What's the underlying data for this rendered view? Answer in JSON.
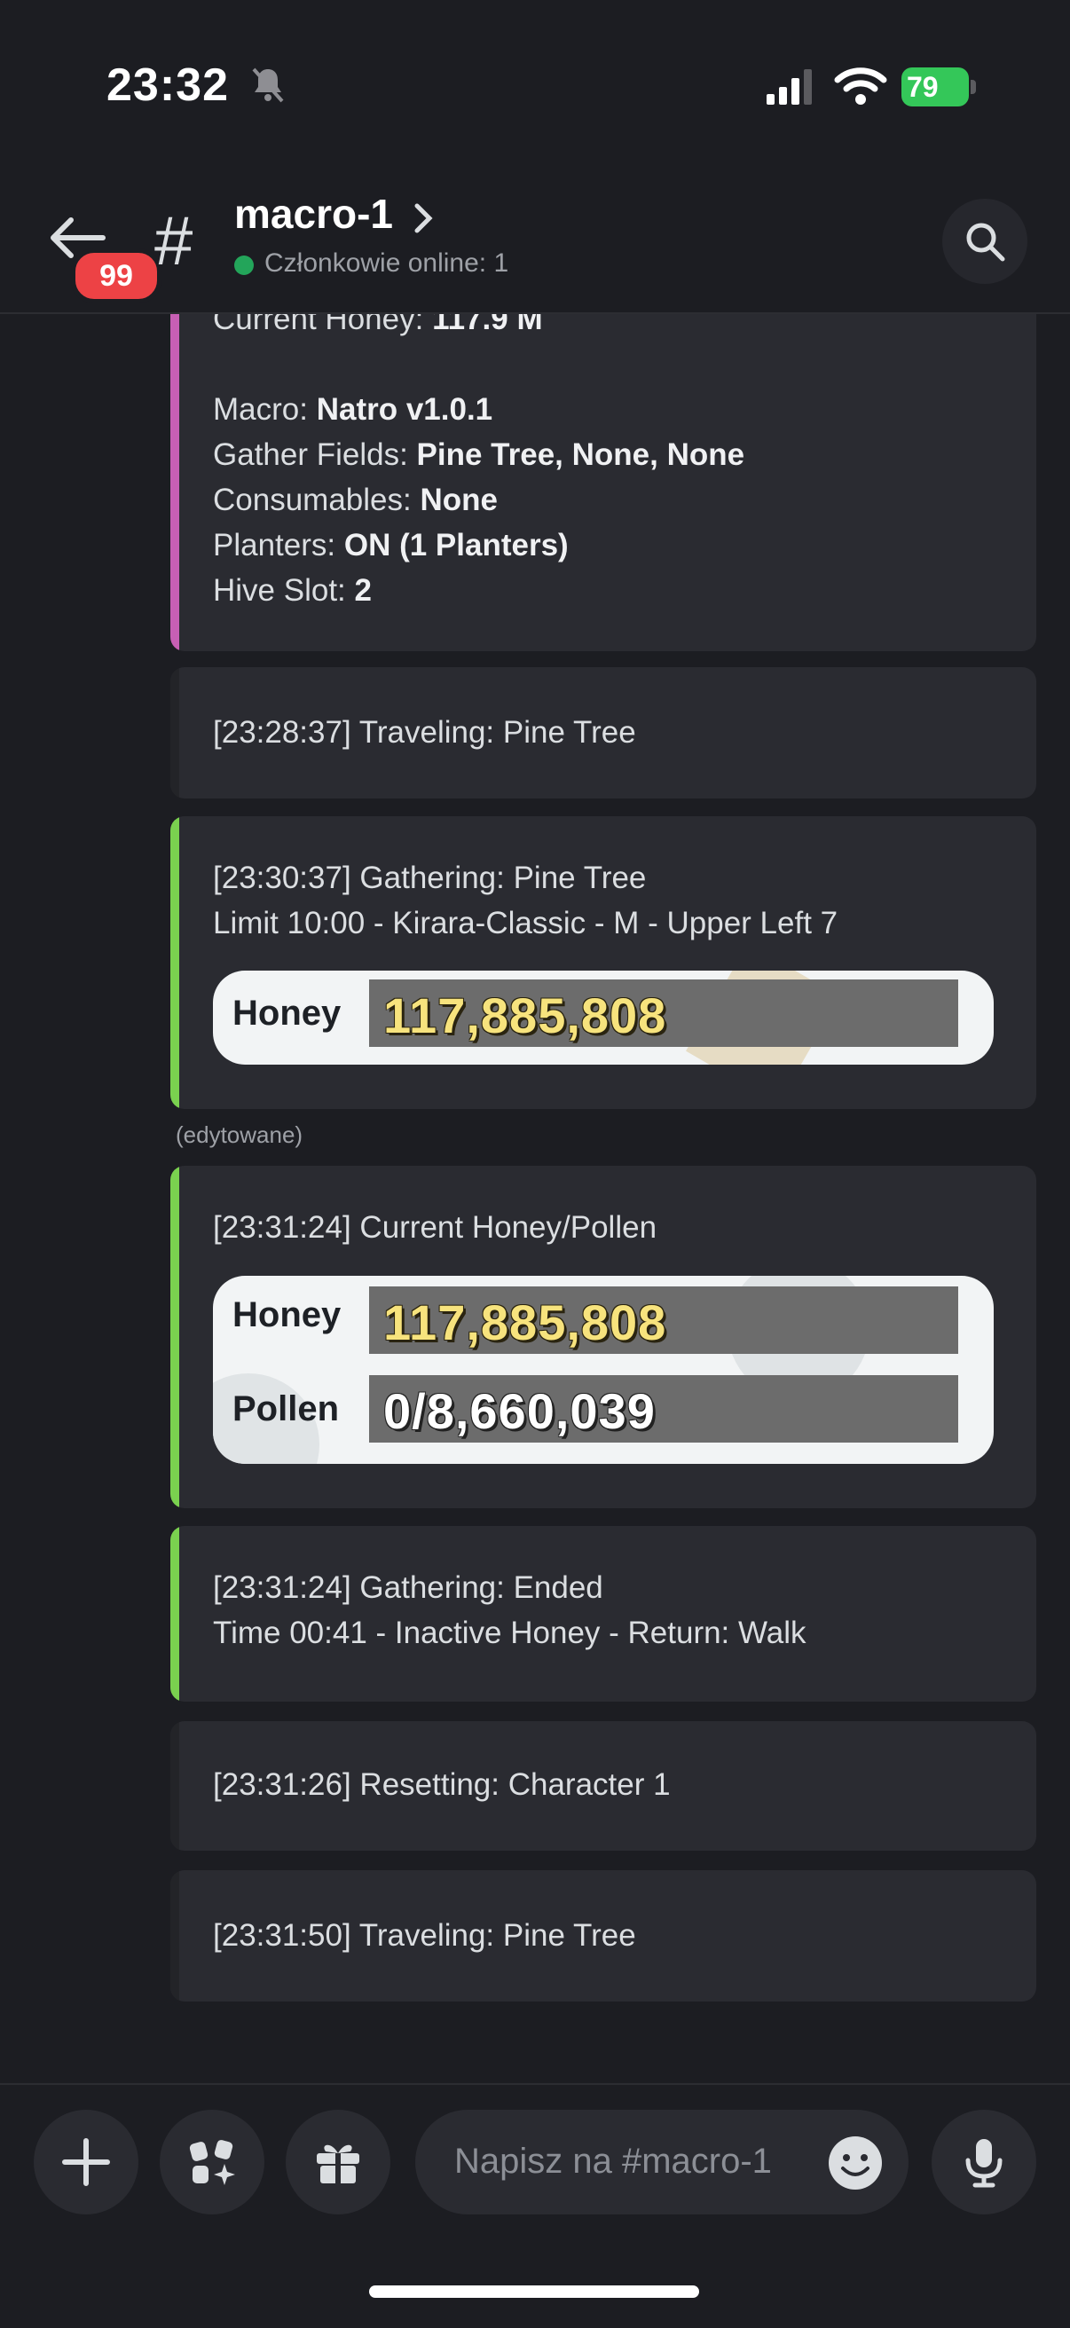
{
  "status_bar": {
    "time": "23:32",
    "battery": "79"
  },
  "header": {
    "unread_badge": "99",
    "hash": "#",
    "channel_name": "macro-1",
    "online_text": "Członkowie online: 1"
  },
  "messages": {
    "embed1": {
      "lines": [
        {
          "label": "Current Honey: ",
          "value": "117.9 M"
        },
        {
          "label": "Macro: ",
          "value": "Natro v1.0.1"
        },
        {
          "label": "Gather Fields: ",
          "value": "Pine Tree, None, None"
        },
        {
          "label": "Consumables: ",
          "value": "None"
        },
        {
          "label": "Planters: ",
          "value": "ON (1 Planters)"
        },
        {
          "label": "Hive Slot: ",
          "value": "2"
        }
      ]
    },
    "m2": {
      "text": "[23:28:37] Traveling: Pine Tree"
    },
    "m3": {
      "line1": "[23:30:37] Gathering: Pine Tree",
      "line2": "Limit 10:00 - Kirara-Classic - M - Upper Left 7",
      "image": {
        "label": "Honey",
        "value": "117,885,808"
      }
    },
    "edited_label": "(edytowane)",
    "m4": {
      "line1": "[23:31:24] Current Honey/Pollen",
      "image": {
        "honey_label": "Honey",
        "honey_value": "117,885,808",
        "pollen_label": "Pollen",
        "pollen_value": "0/8,660,039"
      }
    },
    "m5": {
      "line1": "[23:31:24] Gathering: Ended",
      "line2": "Time 00:41 - Inactive Honey - Return: Walk"
    },
    "m6": {
      "text": "[23:31:26] Resetting: Character 1"
    },
    "m7": {
      "text": "[23:31:50] Traveling: Pine Tree"
    }
  },
  "composer": {
    "placeholder": "Napisz na #macro-1"
  },
  "colors": {
    "pink_bar": "#c75fb4",
    "green_bar": "#7ad14f",
    "badge": "#ed4245",
    "online": "#23a55a"
  },
  "icons": [
    "muted-bell-icon",
    "signal-icon",
    "wifi-icon",
    "battery-icon",
    "back-arrow-icon",
    "chevron-right-icon",
    "search-icon",
    "plus-icon",
    "apps-icon",
    "gift-icon",
    "emoji-icon",
    "microphone-icon"
  ]
}
